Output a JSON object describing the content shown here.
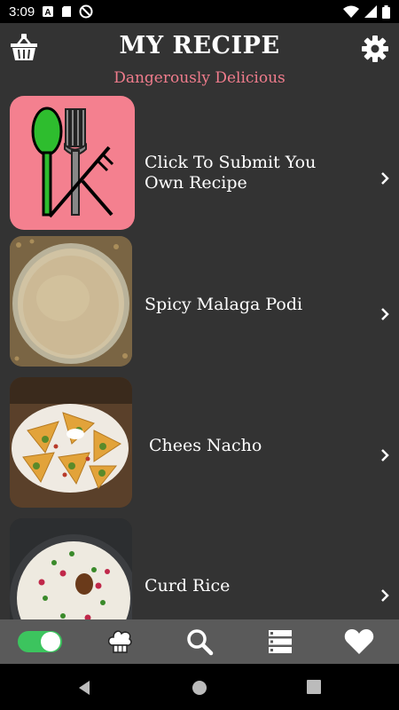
{
  "status_bar": {
    "time": "3:09",
    "icons": [
      "text-notification-icon",
      "sd-card-icon",
      "no-sync-icon",
      "wifi-icon",
      "cell-signal-icon",
      "battery-icon"
    ]
  },
  "header": {
    "title": "MY RECIPE",
    "subtitle": "Dangerously Delicious",
    "left_icon": "basket-icon",
    "right_icon": "gear-icon"
  },
  "recipes": [
    {
      "label": "Click To Submit You Own Recipe",
      "thumb": "utensils-icon"
    },
    {
      "label": "Spicy Malaga Podi",
      "thumb": "podi-powder-image"
    },
    {
      "label": "Chees Nacho",
      "thumb": "nacho-plate-image"
    },
    {
      "label": "Curd Rice",
      "thumb": "curd-rice-image"
    }
  ],
  "bottom_nav": {
    "items": [
      "toggle-switch",
      "chef-hat-icon",
      "search-icon",
      "list-icon",
      "heart-icon"
    ],
    "toggle_on": true
  },
  "colors": {
    "background": "#333333",
    "accent_pink": "#f07c8c",
    "thumb_pink": "#f4808f",
    "spoon_green": "#2ebd2e",
    "toggle_green": "#3cc45e",
    "nav_bar": "#5a5a5a"
  }
}
